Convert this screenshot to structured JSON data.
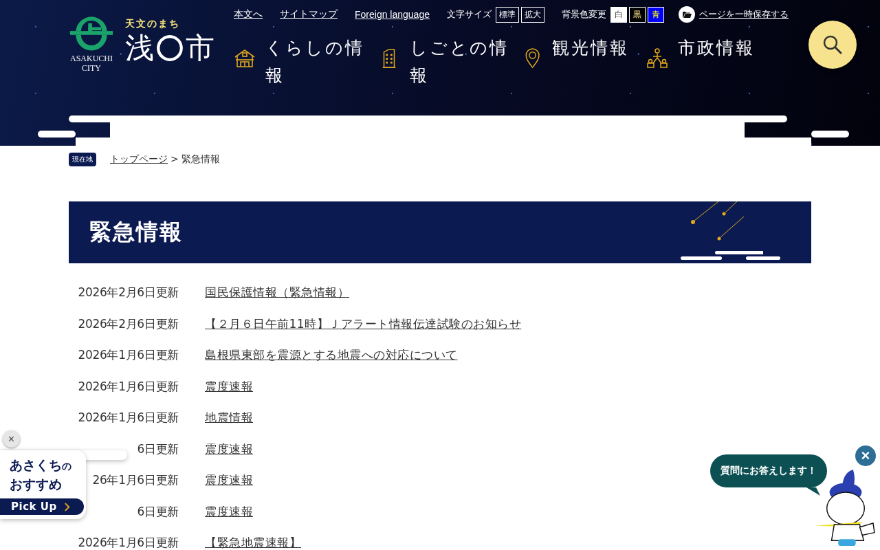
{
  "logo": {
    "tagline": "天文のまち",
    "city_en_line1": "ASAKUCHI",
    "city_en_line2": "CITY",
    "city_name_1": "浅",
    "city_name_2": "市"
  },
  "utility_links": [
    "本文へ",
    "サイトマップ",
    "Foreign language"
  ],
  "font_size": {
    "label": "文字サイズ",
    "options": [
      {
        "label": "標準"
      },
      {
        "label": "拡大"
      }
    ]
  },
  "bg_color": {
    "label": "背景色変更",
    "options": [
      {
        "label": "白",
        "color": "#ffffff"
      },
      {
        "label": "黒",
        "color": "#000000"
      },
      {
        "label": "青",
        "color": "#0000ff"
      }
    ]
  },
  "save_page": "ページを一時保存する",
  "nav": [
    {
      "label": "くらしの情報"
    },
    {
      "label": "しごとの情報"
    },
    {
      "label": "観光情報"
    },
    {
      "label": "市政情報"
    }
  ],
  "breadcrumb": {
    "badge": "現在地",
    "link": "トップページ",
    "separator": ">",
    "current": "緊急情報"
  },
  "page_title": "緊急情報",
  "news": [
    {
      "date": "2026年2月6日更新",
      "title": "国民保護情報（緊急情報）"
    },
    {
      "date": "2026年2月6日更新",
      "title": "【２月６日午前11時】Ｊアラート情報伝達試験のお知らせ"
    },
    {
      "date": "2026年1月6日更新",
      "title": "島根県東部を震源とする地震への対応について"
    },
    {
      "date": "2026年1月6日更新",
      "title": "震度速報"
    },
    {
      "date": "2026年1月6日更新",
      "title": "地震情報"
    },
    {
      "date": "6日更新",
      "title": "震度速報"
    },
    {
      "date": "26年1月6日更新",
      "title": "震度速報"
    },
    {
      "date": "6日更新",
      "title": "震度速報"
    },
    {
      "date": "2026年1月6日更新",
      "title": "【緊急地震速報】"
    }
  ],
  "pickup": {
    "close": "×",
    "title_main": "あさくち",
    "title_small": "の",
    "title_line2": "おすすめ",
    "button": "Pick Up"
  },
  "chat": {
    "bubble": "質問にお答えします！",
    "close": "×"
  }
}
